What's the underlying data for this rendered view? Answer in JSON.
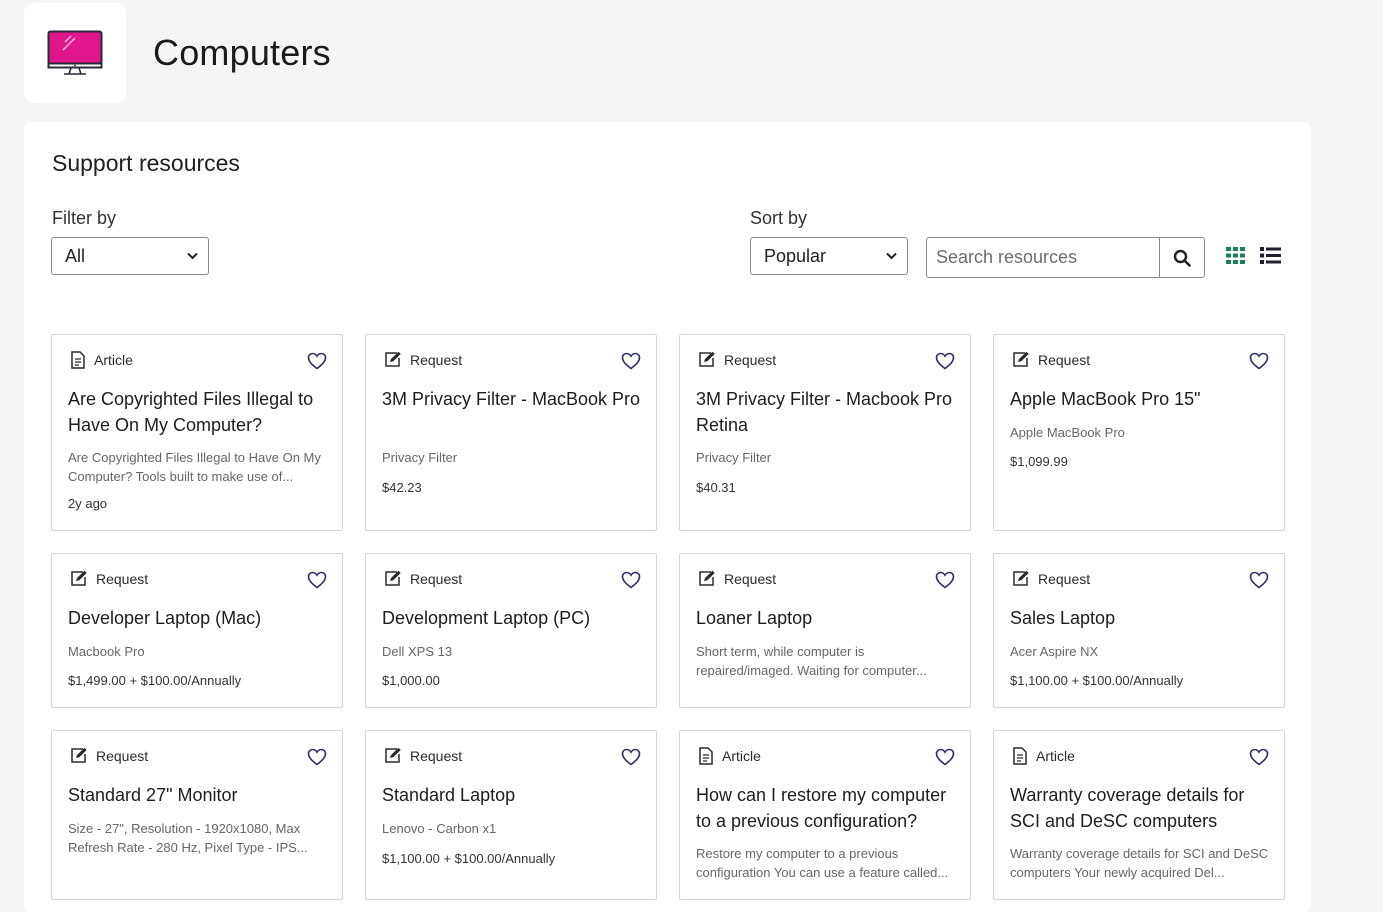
{
  "header": {
    "title": "Computers"
  },
  "panel": {
    "title": "Support resources",
    "filter_label": "Filter by",
    "filter_value": "All",
    "sort_label": "Sort by",
    "sort_value": "Popular",
    "search_placeholder": "Search resources"
  },
  "colors": {
    "logo_accent": "#e0168c",
    "grid_icon": "#1a7f5a",
    "heart": "#2f2f6b"
  },
  "cards": [
    {
      "type": "Article",
      "icon": "document-icon",
      "title": "Are Copyrighted Files Illegal to Have On My Computer?",
      "desc": "Are Copyrighted Files Illegal to Have On My Computer? Tools built to make use of...",
      "meta": "2y ago"
    },
    {
      "type": "Request",
      "icon": "edit-icon",
      "title": "3M Privacy Filter - MacBook Pro",
      "desc": "Privacy Filter",
      "meta": "$42.23"
    },
    {
      "type": "Request",
      "icon": "edit-icon",
      "title": "3M Privacy Filter - Macbook Pro Retina",
      "desc": "Privacy Filter",
      "meta": "$40.31"
    },
    {
      "type": "Request",
      "icon": "edit-icon",
      "title": "Apple MacBook Pro 15\"",
      "desc": "Apple MacBook Pro",
      "meta": "$1,099.99"
    },
    {
      "type": "Request",
      "icon": "edit-icon",
      "title": "Developer Laptop (Mac)",
      "desc": "Macbook Pro",
      "meta": "$1,499.00 + $100.00/Annually"
    },
    {
      "type": "Request",
      "icon": "edit-icon",
      "title": "Development Laptop (PC)",
      "desc": "Dell XPS 13",
      "meta": "$1,000.00"
    },
    {
      "type": "Request",
      "icon": "edit-icon",
      "title": "Loaner Laptop",
      "desc": "Short term, while computer is repaired/imaged. Waiting for computer...",
      "meta": ""
    },
    {
      "type": "Request",
      "icon": "edit-icon",
      "title": "Sales Laptop",
      "desc": "Acer Aspire NX",
      "meta": "$1,100.00 + $100.00/Annually"
    },
    {
      "type": "Request",
      "icon": "edit-icon",
      "title": "Standard 27\" Monitor",
      "desc": "Size - 27\", Resolution - 1920x1080, Max Refresh Rate - 280 Hz, Pixel Type - IPS...",
      "meta": ""
    },
    {
      "type": "Request",
      "icon": "edit-icon",
      "title": "Standard Laptop",
      "desc": "Lenovo - Carbon x1",
      "meta": "$1,100.00 + $100.00/Annually"
    },
    {
      "type": "Article",
      "icon": "document-icon",
      "title": "How can I restore my computer to a previous configuration?",
      "desc": "Restore my computer to a previous configuration You can use a feature called...",
      "meta": ""
    },
    {
      "type": "Article",
      "icon": "document-icon",
      "title": "Warranty coverage details for SCI and DeSC computers",
      "desc": "Warranty coverage details for SCI and DeSC computers Your newly acquired Del...",
      "meta": ""
    }
  ]
}
